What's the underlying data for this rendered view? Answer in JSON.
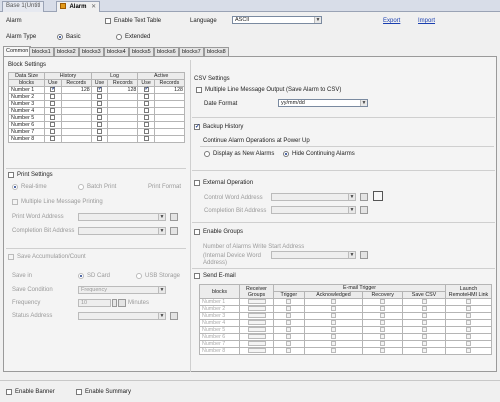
{
  "doc_tabs": [
    {
      "label": "Base 1(Untitl",
      "active": false
    },
    {
      "label": "Alarm",
      "active": true
    }
  ],
  "header": {
    "alarm_label": "Alarm",
    "enable_text_table": "Enable Text Table",
    "language_label": "Language",
    "language_value": "ASCII",
    "export_link": "Export",
    "import_link": "Import",
    "alarm_type_label": "Alarm Type",
    "basic_label": "Basic",
    "extended_label": "Extended"
  },
  "sub_tabs": [
    "Common",
    "blocks1",
    "blocks2",
    "blocks3",
    "blocks4",
    "blocks5",
    "blocks6",
    "blocks7",
    "blocks8"
  ],
  "block_settings": {
    "title": "Block Settings",
    "col_data_size": "Data Size",
    "col_blocks": "blocks",
    "col_history": "History",
    "col_log": "Log",
    "col_active": "Active",
    "col_use": "Use",
    "col_records": "Records",
    "rows": [
      {
        "name": "Number 1",
        "history_use": true,
        "history_records": "128",
        "log_use": true,
        "log_records": "128",
        "active_use": true,
        "active_records": "128"
      },
      {
        "name": "Number 2",
        "history_use": false,
        "history_records": "",
        "log_use": false,
        "log_records": "",
        "active_use": false,
        "active_records": ""
      },
      {
        "name": "Number 3",
        "history_use": false,
        "history_records": "",
        "log_use": false,
        "log_records": "",
        "active_use": false,
        "active_records": ""
      },
      {
        "name": "Number 4",
        "history_use": false,
        "history_records": "",
        "log_use": false,
        "log_records": "",
        "active_use": false,
        "active_records": ""
      },
      {
        "name": "Number 5",
        "history_use": false,
        "history_records": "",
        "log_use": false,
        "log_records": "",
        "active_use": false,
        "active_records": ""
      },
      {
        "name": "Number 6",
        "history_use": false,
        "history_records": "",
        "log_use": false,
        "log_records": "",
        "active_use": false,
        "active_records": ""
      },
      {
        "name": "Number 7",
        "history_use": false,
        "history_records": "",
        "log_use": false,
        "log_records": "",
        "active_use": false,
        "active_records": ""
      },
      {
        "name": "Number 8",
        "history_use": false,
        "history_records": "",
        "log_use": false,
        "log_records": "",
        "active_use": false,
        "active_records": ""
      }
    ]
  },
  "print_settings": {
    "title": "Print Settings",
    "realtime": "Real-time",
    "batch_print": "Batch Print",
    "print_format": "Print Format",
    "multiple_line": "Multiple Line Message Printing",
    "print_word_address": "Print Word Address",
    "completion_bit_address": "Completion Bit Address"
  },
  "save_accum": {
    "title": "Save Accumulation/Count",
    "save_in": "Save in",
    "sd_card": "SD Card",
    "usb_storage": "USB Storage",
    "save_condition": "Save Condition",
    "save_condition_value": "Frequency",
    "frequency": "Frequency",
    "frequency_value": "10",
    "minutes": "Minutes",
    "status_address": "Status Address"
  },
  "csv": {
    "title": "CSV Settings",
    "multiple_line_output": "Multiple Line Message Output (Save Alarm to CSV)",
    "date_format_label": "Date Format",
    "date_format_value": "yy/mm/dd"
  },
  "backup": {
    "title": "Backup History",
    "continue_label": "Continue Alarm Operations at Power Up",
    "display_new": "Display as New Alarms",
    "hide_continuing": "Hide Continuing Alarms"
  },
  "external": {
    "title": "External Operation",
    "control_word": "Control Word Address",
    "completion_bit": "Completion Bit Address"
  },
  "groups": {
    "title": "Enable Groups",
    "num_alarms": "Number of Alarms Write Start Address",
    "internal_device": "(Internal Device Word Address)"
  },
  "email": {
    "title": "Send E-mail",
    "col_blocks": "blocks",
    "col_receiver": "Receiver Groups",
    "col_trigger_group": "E-mail Trigger",
    "col_trigger": "Trigger",
    "col_ack": "Acknowledged",
    "col_recovery": "Recovery",
    "col_save_csv": "Save CSV",
    "col_launch": "Launch RemoteHMI Link",
    "rows": [
      "Number 1",
      "Number 2",
      "Number 3",
      "Number 4",
      "Number 5",
      "Number 6",
      "Number 7",
      "Number 8"
    ]
  },
  "bottom": {
    "enable_banner": "Enable Banner",
    "enable_summary": "Enable Summary"
  }
}
